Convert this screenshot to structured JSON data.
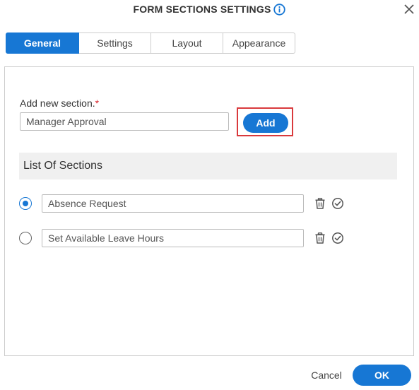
{
  "dialog": {
    "title": "FORM SECTIONS SETTINGS",
    "info_icon": "info-icon",
    "close_icon": "close-icon"
  },
  "tabs": [
    {
      "label": "General",
      "active": true
    },
    {
      "label": "Settings",
      "active": false
    },
    {
      "label": "Layout",
      "active": false
    },
    {
      "label": "Appearance",
      "active": false
    }
  ],
  "general": {
    "new_section_label": "Add new section.",
    "required_marker": "*",
    "new_section_value": "Manager Approval",
    "add_label": "Add",
    "list_header": "List Of Sections",
    "sections": [
      {
        "name": "Absence Request",
        "selected": true
      },
      {
        "name": "Set Available Leave Hours",
        "selected": false
      }
    ],
    "row_icons": [
      "trash-icon",
      "check-circle-icon"
    ]
  },
  "footer": {
    "cancel_label": "Cancel",
    "ok_label": "OK"
  },
  "colors": {
    "primary": "#1777d4",
    "highlight_border": "#d9393c",
    "required": "#d9272e",
    "list_header_bg": "#f0f0f0"
  }
}
